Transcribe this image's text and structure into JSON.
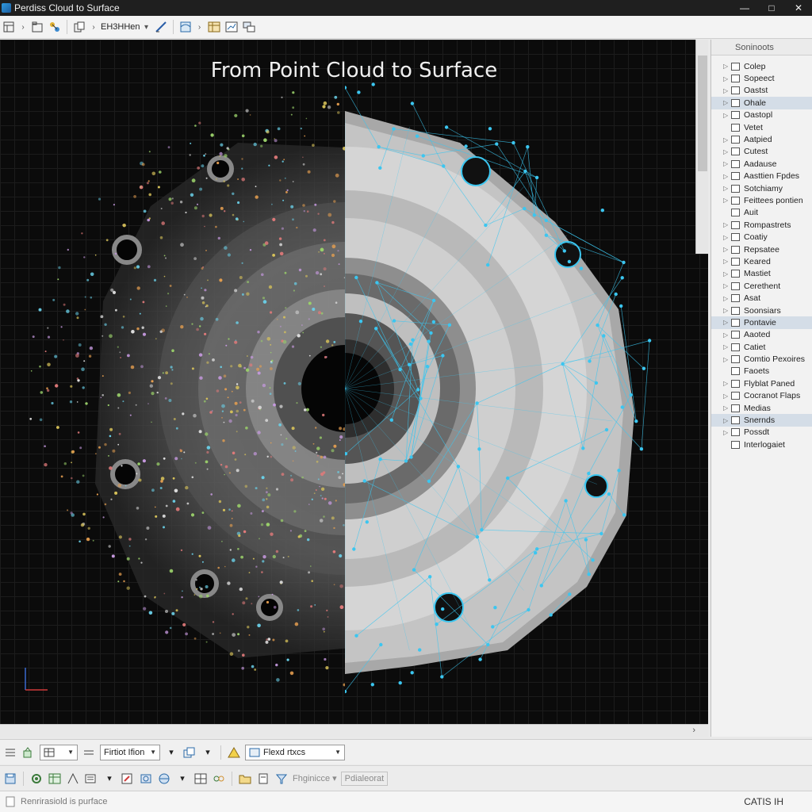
{
  "window": {
    "title": "Perdiss Cloud to Surface"
  },
  "toolbar": {
    "dropdown_label": "EH3HHen"
  },
  "viewport": {
    "title": "From Point Cloud to Surface"
  },
  "panel": {
    "header": "Soninoots",
    "items": [
      {
        "label": "Colep",
        "expandable": true
      },
      {
        "label": "Sopeect",
        "expandable": true
      },
      {
        "label": "Oastst",
        "expandable": true
      },
      {
        "label": "Ohale",
        "expandable": true,
        "selected": true
      },
      {
        "label": "Oastopl",
        "expandable": true
      },
      {
        "label": "Vetet",
        "expandable": false
      },
      {
        "label": "Aatpied",
        "expandable": true
      },
      {
        "label": "Cutest",
        "expandable": true
      },
      {
        "label": "Aadause",
        "expandable": true
      },
      {
        "label": "Aasttien Fpdes",
        "expandable": true
      },
      {
        "label": "Sotchiamy",
        "expandable": true
      },
      {
        "label": "Feittees pontien",
        "expandable": true
      },
      {
        "label": "Auit",
        "expandable": false
      },
      {
        "label": "Rompastrets",
        "expandable": true
      },
      {
        "label": "Coatiy",
        "expandable": true
      },
      {
        "label": "Repsatee",
        "expandable": true
      },
      {
        "label": "Keared",
        "expandable": true
      },
      {
        "label": "Mastiet",
        "expandable": true
      },
      {
        "label": "Cerethent",
        "expandable": true
      },
      {
        "label": "Asat",
        "expandable": true
      },
      {
        "label": "Soonsiars",
        "expandable": true
      },
      {
        "label": "Pontavie",
        "expandable": true,
        "selected": true
      },
      {
        "label": "Aaoted",
        "expandable": true
      },
      {
        "label": "Catiet",
        "expandable": true
      },
      {
        "label": "Comtio Pexoires",
        "expandable": true
      },
      {
        "label": "Faoets",
        "expandable": false
      },
      {
        "label": "Flyblat Paned",
        "expandable": true
      },
      {
        "label": "Cocranot Flaps",
        "expandable": true
      },
      {
        "label": "Medias",
        "expandable": true
      },
      {
        "label": "Snernds",
        "expandable": true,
        "selected": true
      },
      {
        "label": "Possdt",
        "expandable": true
      },
      {
        "label": "Interlogaiet",
        "expandable": false
      }
    ]
  },
  "bottom_bar_1": {
    "dropdown_1": "Firtiot Ifion",
    "dropdown_2": "Flexd rtxcs"
  },
  "bottom_bar_2": {
    "label_1": "Fhginicce",
    "label_2": "Pdialeorat"
  },
  "status": {
    "text": "Renrirasiold is purface",
    "brand": "CATIS IH"
  },
  "colors": {
    "mesh_accent": "#3bc6f0",
    "viewport_bg": "#0b0b0b"
  }
}
